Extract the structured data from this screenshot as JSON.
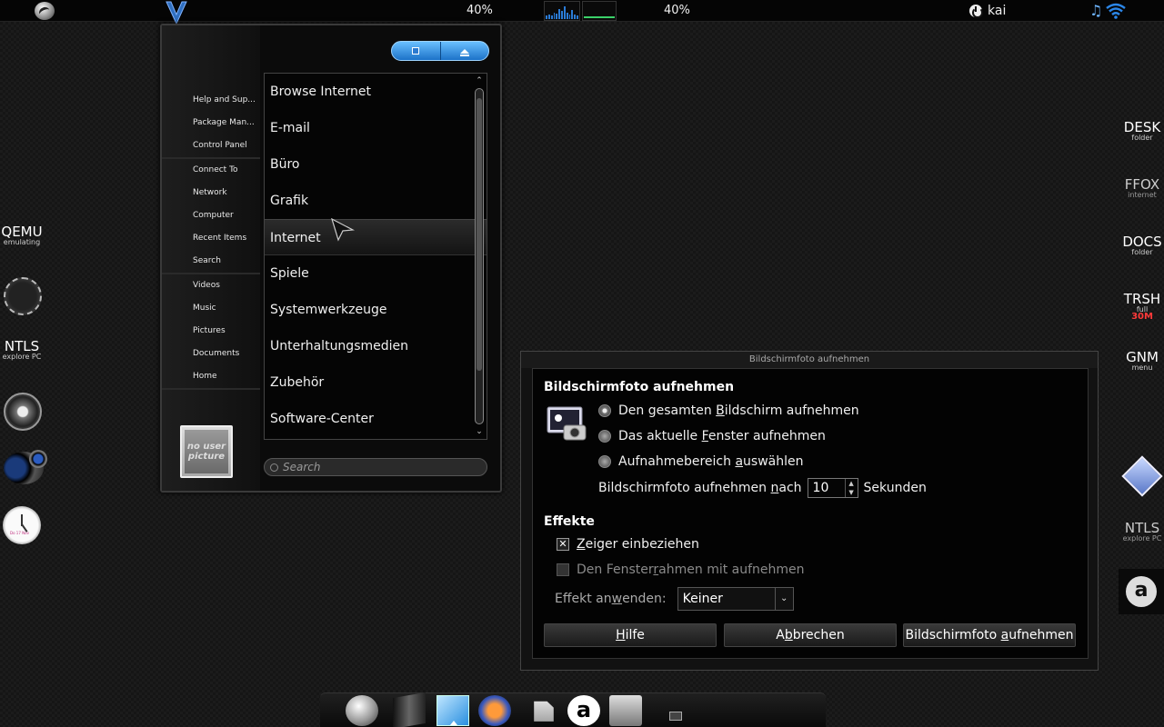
{
  "top_panel": {
    "cpu_percent": "40%",
    "mem_percent": "40%",
    "user_name": "kai",
    "cpu_graph_levels": [
      0.2,
      0.3,
      0.25,
      0.4,
      0.35,
      0.6,
      0.5,
      0.8,
      0.4,
      0.3,
      0.55,
      0.3,
      0.2
    ]
  },
  "desktop_left": {
    "qemu": {
      "title": "QEMU",
      "subtitle": "emulating"
    },
    "ntls": {
      "title": "NTLS",
      "subtitle": "explore PC"
    },
    "clock_date": "Do 17 Nov"
  },
  "start_menu": {
    "places": [
      "Help and Sup...",
      "Package Man...",
      "Control Panel",
      "Connect To",
      "Network",
      "Computer",
      "Recent Items",
      "Search",
      "Videos",
      "Music",
      "Pictures",
      "Documents",
      "Home"
    ],
    "avatar_text": "no user picture",
    "apps": [
      "Browse Internet",
      "E-mail",
      "Büro",
      "Grafik",
      "Internet",
      "Spiele",
      "Systemwerkzeuge",
      "Unterhaltungsmedien",
      "Zubehör",
      "Software-Center"
    ],
    "highlighted_app": "Internet",
    "search_placeholder": "Search"
  },
  "dialog": {
    "window_title": "Bildschirmfoto aufnehmen",
    "heading": "Bildschirmfoto aufnehmen",
    "options": [
      {
        "pre": "Den gesamten ",
        "acc": "B",
        "post": "ildschirm aufnehmen",
        "selected": true
      },
      {
        "pre": "Das aktuelle ",
        "acc": "F",
        "post": "enster aufnehmen",
        "selected": false
      },
      {
        "pre": "Aufnahmebereich ",
        "acc": "a",
        "post": "uswählen",
        "selected": false
      }
    ],
    "delay_pre": "Bildschirmfoto aufnehmen ",
    "delay_acc": "n",
    "delay_post": "ach",
    "delay_value": "10",
    "delay_unit": "Sekunden",
    "effects_heading": "Effekte",
    "include_pointer": {
      "acc": "Z",
      "post": "eiger einbeziehen",
      "checked": true
    },
    "include_border": {
      "pre": "Den Fenster",
      "acc": "r",
      "post": "ahmen mit aufnehmen",
      "checked": false
    },
    "apply_effect_pre": "Effekt an",
    "apply_effect_acc": "w",
    "apply_effect_post": "enden:",
    "effect_value": "Keiner",
    "buttons": {
      "help": {
        "acc": "H",
        "post": "ilfe"
      },
      "cancel": {
        "pre": "A",
        "acc": "b",
        "post": "brechen"
      },
      "take": {
        "pre": "Bildschirmfoto ",
        "acc": "a",
        "post": "ufnehmen"
      }
    }
  },
  "desktop_right": [
    {
      "title": "DESK",
      "subtitle": "folder"
    },
    {
      "title": "FFOX",
      "subtitle": "internet"
    },
    {
      "title": "DOCS",
      "subtitle": "folder"
    },
    {
      "title": "TRSH",
      "subtitle": "full",
      "size": "30M"
    },
    {
      "title": "GNM",
      "subtitle": "menu"
    },
    {
      "title": "NTLS",
      "subtitle": "explore PC"
    }
  ],
  "dock": {
    "items": [
      "ubuntu-logo",
      "terminal",
      "file-manager",
      "firefox",
      "document",
      "amazon",
      "screenshot"
    ],
    "amazon_glyph": "a"
  },
  "colors": {
    "accent_blue": "#2a7bd6",
    "mem_green": "#3bd16a",
    "trash_red": "#ff3a3a"
  }
}
